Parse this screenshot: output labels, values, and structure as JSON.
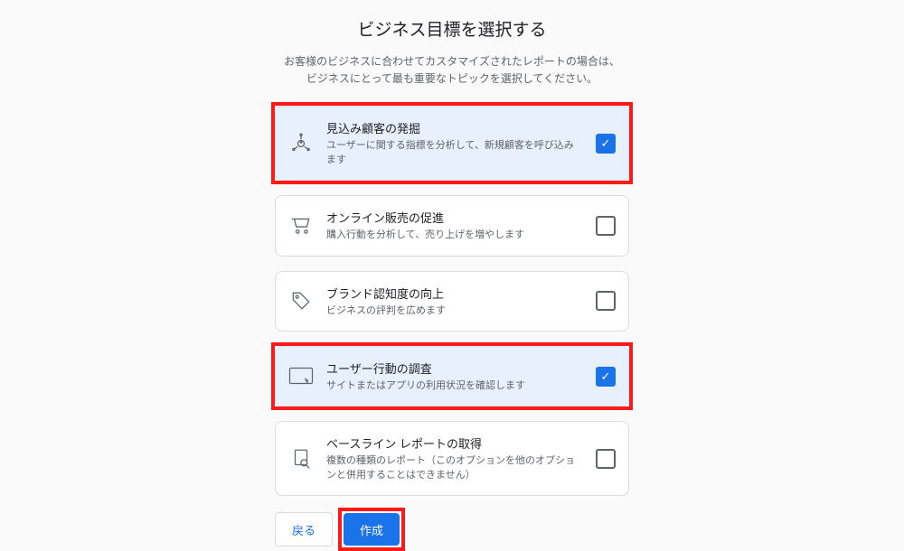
{
  "title": "ビジネス目標を選択する",
  "subtitle_line1": "お客様のビジネスに合わせてカスタマイズされたレポートの場合は、",
  "subtitle_line2": "ビジネスにとって最も重要なトピックを選択してください。",
  "options": [
    {
      "id": "leads",
      "title": "見込み顧客の発掘",
      "desc": "ユーザーに関する指標を分析して、新規顧客を呼び込みます",
      "selected": true,
      "highlighted": true
    },
    {
      "id": "sales",
      "title": "オンライン販売の促進",
      "desc": "購入行動を分析して、売り上げを増やします",
      "selected": false,
      "highlighted": false
    },
    {
      "id": "brand",
      "title": "ブランド認知度の向上",
      "desc": "ビジネスの評判を広めます",
      "selected": false,
      "highlighted": false
    },
    {
      "id": "behavior",
      "title": "ユーザー行動の調査",
      "desc": "サイトまたはアプリの利用状況を確認します",
      "selected": true,
      "highlighted": true
    },
    {
      "id": "baseline",
      "title": "ベースライン レポートの取得",
      "desc": "複数の種類のレポート（このオプションを他のオプションと併用することはできません）",
      "selected": false,
      "highlighted": false
    }
  ],
  "buttons": {
    "back": "戻る",
    "create": "作成"
  },
  "colors": {
    "highlight": "#ff1a1a",
    "primary": "#1a73e8"
  }
}
